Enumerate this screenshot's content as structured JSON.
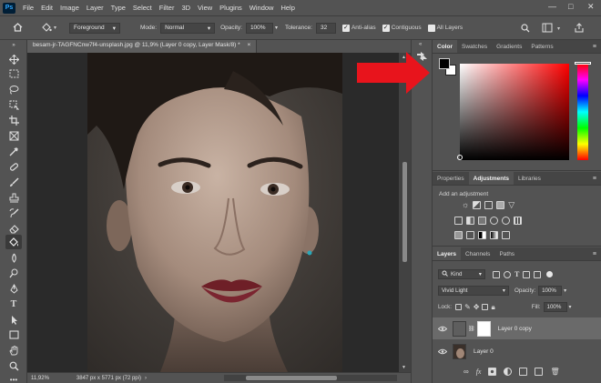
{
  "menubar": {
    "logo": "Ps",
    "items": [
      "File",
      "Edit",
      "Image",
      "Layer",
      "Type",
      "Select",
      "Filter",
      "3D",
      "View",
      "Plugins",
      "Window",
      "Help"
    ],
    "window_controls": [
      "—",
      "□",
      "✕"
    ]
  },
  "options": {
    "fill_source": "Foreground",
    "mode_label": "Mode:",
    "mode_value": "Normal",
    "opacity_label": "Opacity:",
    "opacity_value": "100%",
    "tolerance_label": "Tolerance:",
    "tolerance_value": "32",
    "anti_alias": "Anti-alias",
    "contiguous": "Contiguous",
    "all_layers": "All Layers"
  },
  "document": {
    "tab_title": "besam-jr-TAGFNCnw7f4-unsplash.jpg @ 11,9% (Layer 0 copy, Layer Mask/8) *",
    "close": "×",
    "zoom": "11,92%",
    "dimensions": "3847 px x 5771 px (72 ppi)"
  },
  "color_panel": {
    "tabs": [
      "Color",
      "Swatches",
      "Gradients",
      "Patterns"
    ],
    "foreground": "#000000",
    "background": "#ffffff",
    "hue": "#ff0000"
  },
  "adjustments_panel": {
    "tabs": [
      "Properties",
      "Adjustments",
      "Libraries"
    ],
    "hint": "Add an adjustment"
  },
  "layers_panel": {
    "tabs": [
      "Layers",
      "Channels",
      "Paths"
    ],
    "filter_kind": "Kind",
    "blend_mode": "Vivid Light",
    "opacity_label": "Opacity:",
    "opacity_value": "100%",
    "lock_label": "Lock:",
    "fill_label": "Fill:",
    "fill_value": "100%",
    "layers": [
      {
        "name": "Layer 0 copy",
        "visible": true,
        "selected": true
      },
      {
        "name": "Layer 0",
        "visible": true,
        "selected": false
      }
    ]
  },
  "colors": {
    "arrow": "#e8141c",
    "panel_bg": "#535353",
    "selected_row": "#6a6a6a"
  }
}
